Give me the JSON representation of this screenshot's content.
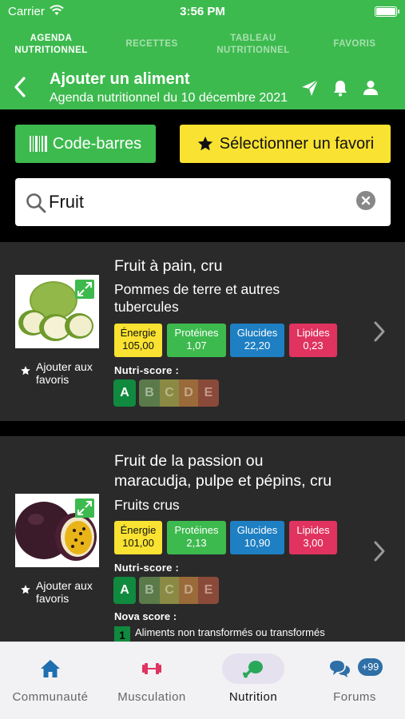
{
  "status_bar": {
    "carrier": "Carrier",
    "time": "3:56 PM"
  },
  "top_nav": {
    "tabs": [
      {
        "label": "AGENDA\nNUTRITIONNEL",
        "active": true
      },
      {
        "label": "RECETTES",
        "active": false
      },
      {
        "label": "TABLEAU\nNUTRITIONNEL",
        "active": false
      },
      {
        "label": "FAVORIS",
        "active": false
      }
    ]
  },
  "header": {
    "title": "Ajouter un aliment",
    "subtitle": "Agenda nutritionnel du 10 décembre 2021",
    "icons": [
      "back-chevron-icon",
      "send-icon",
      "bell-icon",
      "user-icon"
    ]
  },
  "actions": {
    "barcode_label": "Code-barres",
    "favorite_label": "Sélectionner un favori"
  },
  "search": {
    "value": "Fruit",
    "placeholder": ""
  },
  "foods": [
    {
      "name": "Fruit à pain, cru",
      "category": "Pommes de terre et autres\ntubercules",
      "energie_label": "Énergie",
      "energie": "105,00",
      "proteines_label": "Protéines",
      "proteines": "1,07",
      "glucides_label": "Glucides",
      "glucides": "22,20",
      "lipides_label": "Lipides",
      "lipides": "0,23",
      "nutri_label": "Nutri-score :",
      "nutri_grades": [
        "A",
        "B",
        "C",
        "D",
        "E"
      ],
      "nutri_selected": "A",
      "fav_label": "Ajouter aux\nfavoris"
    },
    {
      "name": "Fruit de la passion ou\nmaracudja, pulpe et pépins, cru",
      "category": "Fruits crus",
      "energie_label": "Énergie",
      "energie": "101,00",
      "proteines_label": "Protéines",
      "proteines": "2,13",
      "glucides_label": "Glucides",
      "glucides": "10,90",
      "lipides_label": "Lipides",
      "lipides": "3,00",
      "nutri_label": "Nutri-score :",
      "nutri_grades": [
        "A",
        "B",
        "C",
        "D",
        "E"
      ],
      "nutri_selected": "A",
      "fav_label": "Ajouter aux\nfavoris",
      "nova_label": "Nova score :",
      "nova_value": "1",
      "nova_text": "Aliments non transformés ou transformés"
    }
  ],
  "tab_bar": {
    "items": [
      {
        "label": "Communauté",
        "icon": "home-icon",
        "active": false
      },
      {
        "label": "Musculation",
        "icon": "dumbbell-icon",
        "active": false
      },
      {
        "label": "Nutrition",
        "icon": "chicken-leg-icon",
        "active": true
      },
      {
        "label": "Forums",
        "icon": "chat-bubbles-icon",
        "active": false,
        "badge": "+99"
      }
    ]
  },
  "colors": {
    "brand_green": "#3dba4e",
    "yellow": "#f9e231",
    "blue": "#1e7fc2",
    "pink": "#e0335f",
    "card_bg": "#2a2a2a",
    "nutri_a": "#108a3e"
  }
}
